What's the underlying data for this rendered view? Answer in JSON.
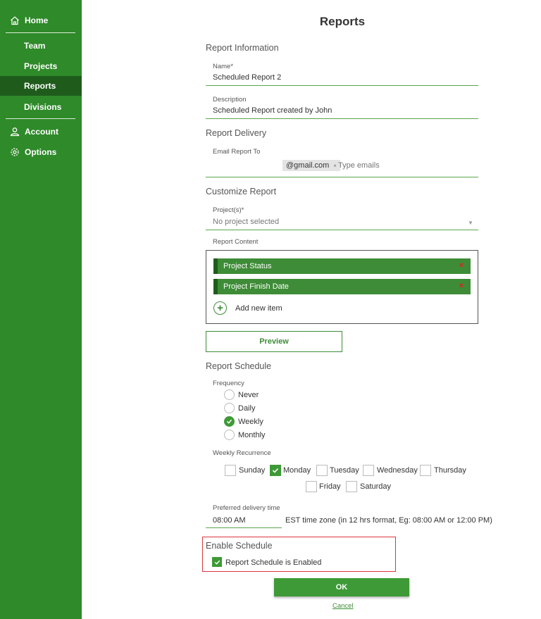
{
  "sidebar": {
    "home": "Home",
    "team": "Team",
    "projects": "Projects",
    "reports": "Reports",
    "divisions": "Divisions",
    "account": "Account",
    "options": "Options"
  },
  "page": {
    "title": "Reports"
  },
  "report_info": {
    "title": "Report Information",
    "name_label": "Name*",
    "name_value": "Scheduled Report 2",
    "desc_label": "Description",
    "desc_value": "Scheduled Report created by John"
  },
  "delivery": {
    "title": "Report Delivery",
    "email_label": "Email Report To",
    "email_chip": "@gmail.com",
    "email_chip_remove": "×",
    "email_placeholder": "Type emails"
  },
  "customize": {
    "title": "Customize Report",
    "projects_label": "Project(s)*",
    "projects_value": "No project selected",
    "content_label": "Report Content",
    "items": [
      {
        "label": "Project Status",
        "remove": "×"
      },
      {
        "label": "Project Finish Date",
        "remove": "×"
      }
    ],
    "add_item": "Add new item",
    "preview": "Preview"
  },
  "schedule": {
    "title": "Report Schedule",
    "frequency_label": "Frequency",
    "frequencies": [
      "Never",
      "Daily",
      "Weekly",
      "Monthly"
    ],
    "frequency_selected": "Weekly",
    "recurrence_label": "Weekly Recurrence",
    "days": [
      "Sunday",
      "Monday",
      "Tuesday",
      "Wednesday",
      "Thursday",
      "Friday",
      "Saturday"
    ],
    "days_checked": [
      "Monday"
    ],
    "time_label": "Preferred delivery time",
    "time_value": "08:00 AM",
    "time_note": "EST time zone (in 12 hrs format, Eg: 08:00 AM or 12:00 PM)"
  },
  "enable": {
    "title": "Enable Schedule",
    "checkbox_label": "Report Schedule is Enabled",
    "checked": true
  },
  "actions": {
    "ok": "OK",
    "cancel": "Cancel"
  },
  "colors": {
    "sidebar": "#2f8a2a",
    "sidebar_active": "#1f5c1c",
    "accent": "#3e9a36",
    "highlight_border": "#d9363e"
  }
}
